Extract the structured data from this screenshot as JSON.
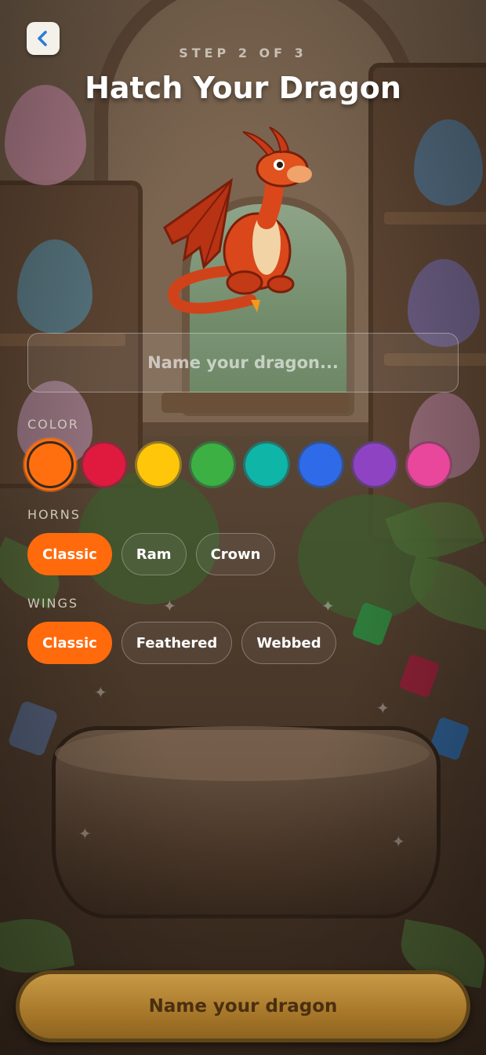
{
  "header": {
    "step_text": "STEP 2 OF 3",
    "title": "Hatch Your Dragon"
  },
  "name_input": {
    "placeholder": "Name your dragon...",
    "value": ""
  },
  "color_section": {
    "label": "COLOR",
    "swatches": [
      {
        "color": "#ff6f0f",
        "selected": true
      },
      {
        "color": "#e0193f",
        "selected": false
      },
      {
        "color": "#ffc60a",
        "selected": false
      },
      {
        "color": "#3cb043",
        "selected": false
      },
      {
        "color": "#0fb5a6",
        "selected": false
      },
      {
        "color": "#2f6ae8",
        "selected": false
      },
      {
        "color": "#8e44c2",
        "selected": false
      },
      {
        "color": "#e8479b",
        "selected": false
      }
    ]
  },
  "horns_section": {
    "label": "HORNS",
    "options": [
      "Classic",
      "Ram",
      "Crown"
    ],
    "selected": "Classic"
  },
  "wings_section": {
    "label": "WINGS",
    "options": [
      "Classic",
      "Feathered",
      "Webbed"
    ],
    "selected": "Classic"
  },
  "cta_label": "Name your dragon",
  "icons": {
    "back": "chevron-left-icon",
    "dragon": "dragon-illustration"
  },
  "colors": {
    "accent": "#ff6a0d",
    "cta": "#b8872f"
  }
}
